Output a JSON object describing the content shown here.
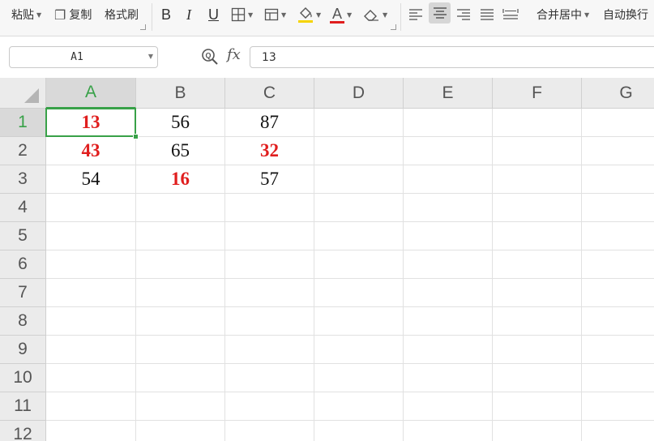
{
  "toolbar": {
    "paste": "粘贴",
    "copy": "复制",
    "format_painter": "格式刷",
    "bold": "B",
    "italic": "I",
    "underline": "U",
    "font_color_glyph": "A",
    "merge_center": "合并居中",
    "wrap_text": "自动换行",
    "colors": {
      "font_color": "#e01e1e",
      "fill_color": "#f5d400"
    }
  },
  "formula_bar": {
    "name_box": "A1",
    "fx_label": "fx",
    "formula_value": "13"
  },
  "sheet": {
    "columns": [
      "A",
      "B",
      "C",
      "D",
      "E",
      "F",
      "G"
    ],
    "rows": [
      "1",
      "2",
      "3",
      "4",
      "5",
      "6",
      "7",
      "8",
      "9",
      "10",
      "11",
      "12"
    ],
    "active_cell": "A1",
    "accent_color": "#38a148",
    "highlight_color": "#e01e1e",
    "cells": [
      [
        {
          "v": "13",
          "red": true
        },
        {
          "v": "56",
          "red": false
        },
        {
          "v": "87",
          "red": false
        }
      ],
      [
        {
          "v": "43",
          "red": true
        },
        {
          "v": "65",
          "red": false
        },
        {
          "v": "32",
          "red": true
        }
      ],
      [
        {
          "v": "54",
          "red": false
        },
        {
          "v": "16",
          "red": true
        },
        {
          "v": "57",
          "red": false
        }
      ]
    ]
  }
}
